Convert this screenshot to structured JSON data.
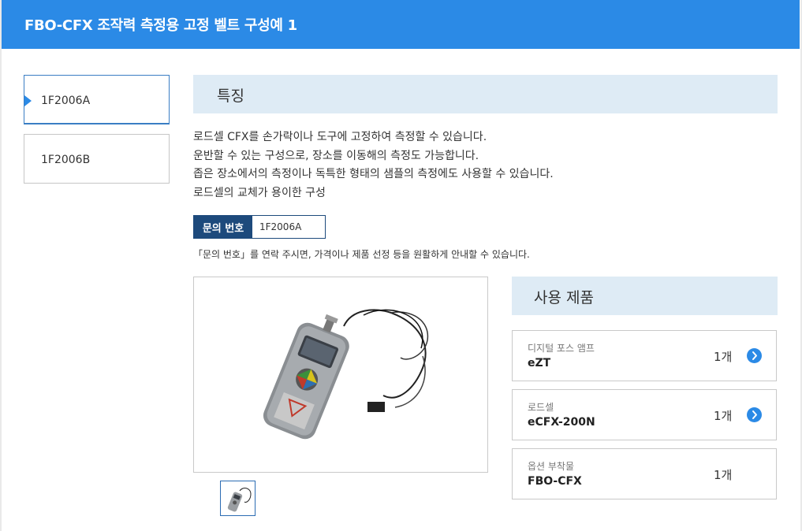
{
  "header": {
    "title": "FBO-CFX 조작력 측정용 고정 벨트 구성예 1"
  },
  "tabs": [
    {
      "label": "1F2006A",
      "active": true
    },
    {
      "label": "1F2006B",
      "active": false
    }
  ],
  "features": {
    "heading": "특징",
    "lines": [
      "로드셀 CFX를 손가락이나 도구에 고정하여 측정할 수 있습니다.",
      "운반할 수 있는 구성으로, 장소를 이동해의 측정도 가능합니다.",
      "좁은 장소에서의 측정이나 독특한 형태의 샘플의 측정에도 사용할 수 있습니다.",
      "로드셀의 교체가 용이한 구성"
    ]
  },
  "inquiry": {
    "label": "문의 번호",
    "value": "1F2006A",
    "note": "「문의 번호」를 연락 주시면, 가격이나 제품 선정 등을 원활하게 안내할 수 있습니다."
  },
  "products": {
    "heading": "사용 제품",
    "items": [
      {
        "category": "디지털 포스 앰프",
        "name": "eZT",
        "qty": "1개",
        "has_link": true
      },
      {
        "category": "로드셀",
        "name": "eCFX-200N",
        "qty": "1개",
        "has_link": true
      },
      {
        "category": "옵션 부착물",
        "name": "FBO-CFX",
        "qty": "1개",
        "has_link": false
      }
    ]
  },
  "colors": {
    "header": "#2b8ae6",
    "section_bg": "#deebf5",
    "inquiry_label": "#1d4a7c"
  },
  "icons": {
    "tab_marker": "triangle-right-icon",
    "product_link": "chevron-circle-right-icon"
  }
}
